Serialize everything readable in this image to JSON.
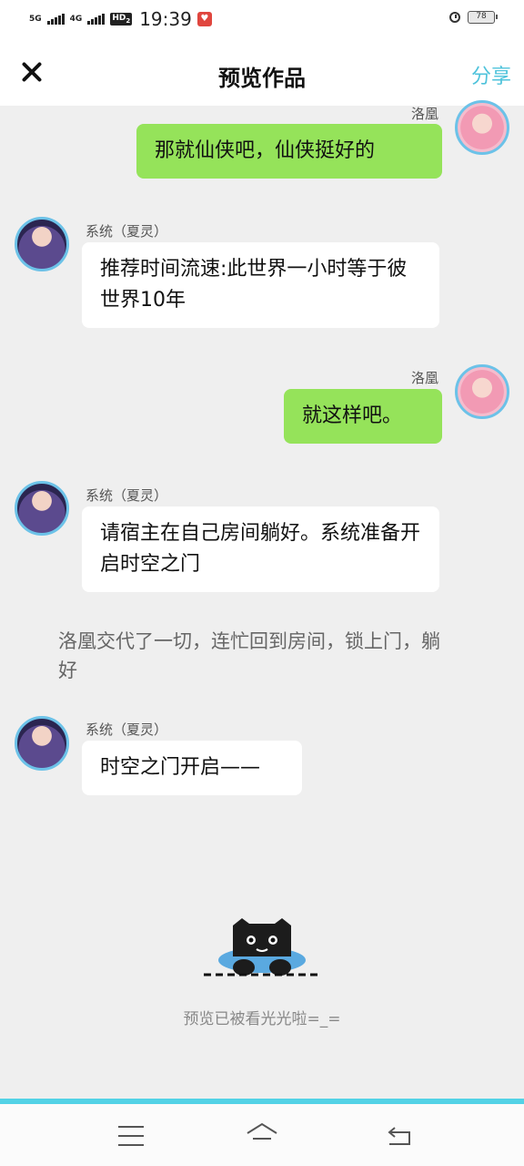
{
  "status_bar": {
    "network_1": "5G",
    "network_2": "4G",
    "hd_label": "HD",
    "hd_sub": "2",
    "time": "19:39",
    "battery": "78"
  },
  "header": {
    "title": "预览作品",
    "share_label": "分享"
  },
  "messages": [
    {
      "side": "right",
      "name": "洛凰",
      "text": "那就仙侠吧，仙侠挺好的"
    },
    {
      "side": "left",
      "name": "系统（夏灵）",
      "text": "推荐时间流速:此世界一小时等于彼世界10年"
    },
    {
      "side": "right",
      "name": "洛凰",
      "text": "就这样吧。"
    },
    {
      "side": "left",
      "name": "系统（夏灵）",
      "text": "请宿主在自己房间躺好。系统准备开启时空之门"
    },
    {
      "side": "narration",
      "text": "洛凰交代了一切，连忙回到房间，锁上门，躺好"
    },
    {
      "side": "left",
      "name": "系统（夏灵）",
      "text": "时空之门开启——"
    }
  ],
  "footer": {
    "end_text": "预览已被看光光啦=_="
  },
  "colors": {
    "accent": "#4fc3db",
    "right_bubble": "#95e35a",
    "left_bubble": "#ffffff",
    "background": "#efefef"
  }
}
